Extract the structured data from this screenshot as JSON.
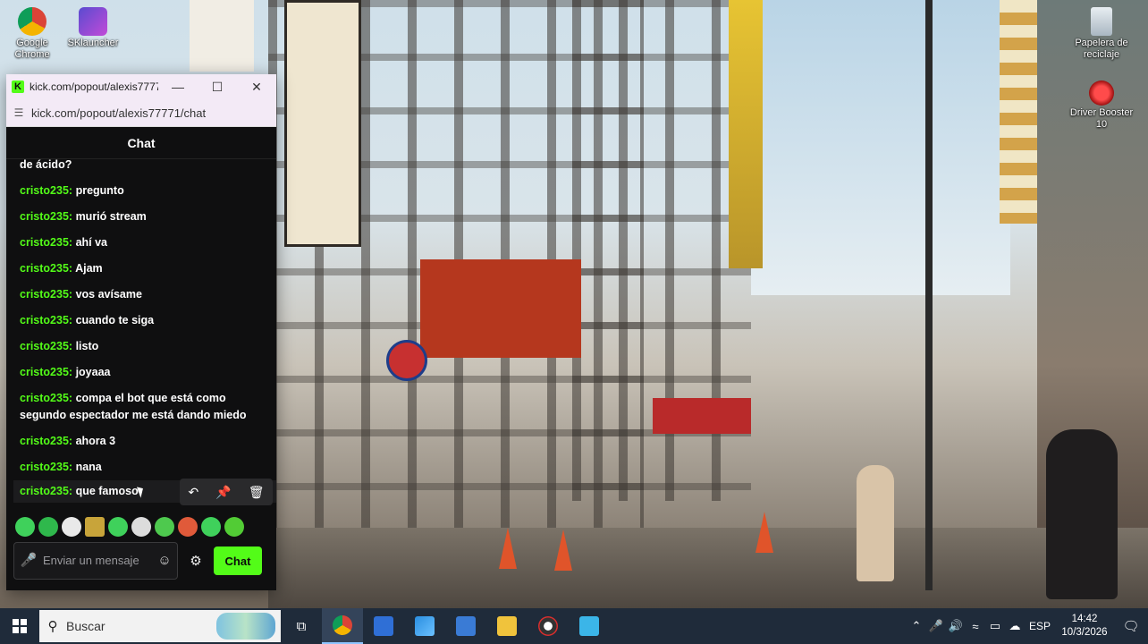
{
  "desktop": {
    "icons": {
      "chrome": {
        "label": "Google Chrome"
      },
      "sklauncher": {
        "label": "SKlauncher"
      },
      "recycle": {
        "label": "Papelera de reciclaje"
      },
      "driverbooster": {
        "label": "Driver Booster 10"
      }
    }
  },
  "popout": {
    "tab_title": "kick.com/popout/alexis7777...",
    "url": "kick.com/popout/alexis77771/chat",
    "chat_title": "Chat",
    "messages": [
      {
        "user": "",
        "text": "de ácido?"
      },
      {
        "user": "cristo235",
        "text": "pregunto"
      },
      {
        "user": "cristo235",
        "text": "murió stream"
      },
      {
        "user": "cristo235",
        "text": "ahí va"
      },
      {
        "user": "cristo235",
        "text": "Ajam"
      },
      {
        "user": "cristo235",
        "text": "vos avísame"
      },
      {
        "user": "cristo235",
        "text": "cuando te siga"
      },
      {
        "user": "cristo235",
        "text": "listo"
      },
      {
        "user": "cristo235",
        "text": "joyaaa"
      },
      {
        "user": "cristo235",
        "text": "compa el bot que está como segundo espectador me está dando miedo"
      },
      {
        "user": "cristo235",
        "text": "ahora 3"
      },
      {
        "user": "cristo235",
        "text": "nana"
      },
      {
        "user": "cristo235",
        "text": "que famoso"
      }
    ],
    "separator": ":",
    "input_placeholder": "Enviar un mensaje",
    "send_label": "Chat"
  },
  "taskbar": {
    "search_placeholder": "Buscar",
    "language": "ESP",
    "time": "14:42",
    "date": "10/3/2026"
  }
}
